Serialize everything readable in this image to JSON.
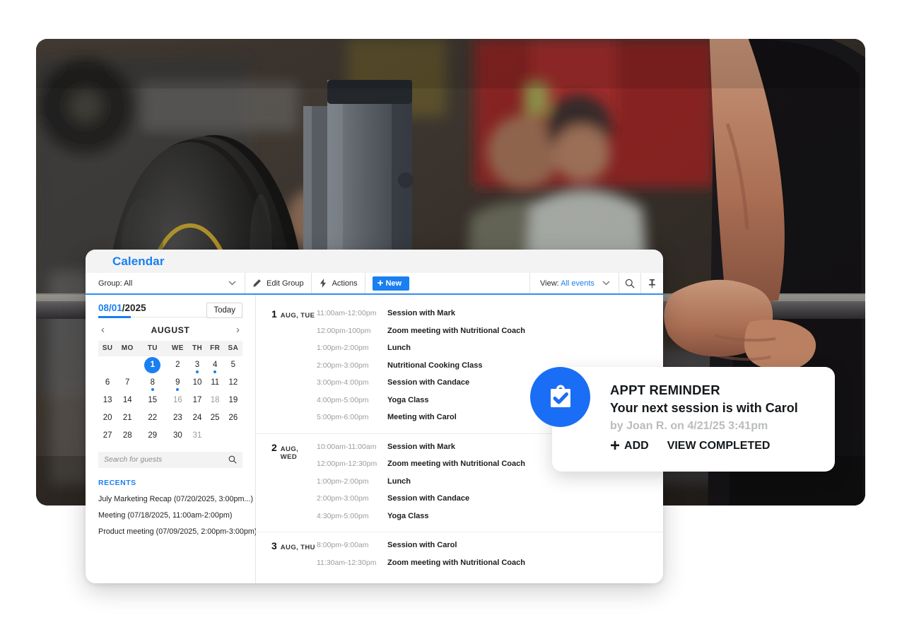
{
  "app": {
    "title": "Calendar"
  },
  "toolbar": {
    "group_label": "Group: All",
    "edit_group_label": "Edit Group",
    "actions_label": "Actions",
    "new_label": "New",
    "new_plus": "+",
    "view_label": "View:",
    "view_value": "All events",
    "accent_color": "#1a7ff0"
  },
  "sidebar": {
    "date_month_day": "08/01",
    "date_year": "/2025",
    "today_label": "Today",
    "month_name": "AUGUST",
    "prev_arrow": "‹",
    "next_arrow": "›",
    "weekdays": [
      "SU",
      "MO",
      "TU",
      "WE",
      "TH",
      "FR",
      "SA"
    ],
    "weeks": [
      [
        {
          "d": "",
          "state": "empty"
        },
        {
          "d": "",
          "state": "empty"
        },
        {
          "d": "1",
          "state": "selected"
        },
        {
          "d": "2",
          "state": "normal"
        },
        {
          "d": "3",
          "state": "normal",
          "dot": true
        },
        {
          "d": "4",
          "state": "normal",
          "dot": true
        },
        {
          "d": "5",
          "state": "normal"
        }
      ],
      [
        {
          "d": "6",
          "state": "normal"
        },
        {
          "d": "7",
          "state": "normal"
        },
        {
          "d": "8",
          "state": "normal",
          "dot": true
        },
        {
          "d": "9",
          "state": "normal",
          "dot": true
        },
        {
          "d": "10",
          "state": "normal"
        },
        {
          "d": "11",
          "state": "normal"
        },
        {
          "d": "12",
          "state": "normal"
        }
      ],
      [
        {
          "d": "13",
          "state": "normal"
        },
        {
          "d": "14",
          "state": "normal"
        },
        {
          "d": "15",
          "state": "normal"
        },
        {
          "d": "16",
          "state": "muted"
        },
        {
          "d": "17",
          "state": "normal"
        },
        {
          "d": "18",
          "state": "muted"
        },
        {
          "d": "19",
          "state": "normal"
        }
      ],
      [
        {
          "d": "20",
          "state": "normal"
        },
        {
          "d": "21",
          "state": "normal"
        },
        {
          "d": "22",
          "state": "normal"
        },
        {
          "d": "23",
          "state": "normal"
        },
        {
          "d": "24",
          "state": "normal"
        },
        {
          "d": "25",
          "state": "normal"
        },
        {
          "d": "26",
          "state": "normal"
        }
      ],
      [
        {
          "d": "27",
          "state": "normal"
        },
        {
          "d": "28",
          "state": "normal"
        },
        {
          "d": "29",
          "state": "normal"
        },
        {
          "d": "30",
          "state": "normal"
        },
        {
          "d": "31",
          "state": "muted"
        },
        {
          "d": "",
          "state": "empty"
        },
        {
          "d": "",
          "state": "empty"
        }
      ]
    ],
    "guest_search_placeholder": "Search for guests",
    "recents_heading": "RECENTS",
    "recents": [
      "July Marketing Recap (07/20/2025, 3:00pm...)",
      "Meeting (07/18/2025, 11:00am-2:00pm)",
      "Product meeting (07/09/2025, 2:00pm-3:00pm)"
    ]
  },
  "event_days": [
    {
      "day": "1",
      "dow": "AUG, TUE",
      "events": [
        {
          "time": "11:00am-12:00pm",
          "name": "Session with Mark"
        },
        {
          "time": "12:00pm-100pm",
          "name": "Zoom meeting with Nutritional Coach"
        },
        {
          "time": "1:00pm-2:00pm",
          "name": "Lunch"
        },
        {
          "time": "2:00pm-3:00pm",
          "name": "Nutritional Cooking Class"
        },
        {
          "time": "3:00pm-4:00pm",
          "name": "Session with Candace"
        },
        {
          "time": "4:00pm-5:00pm",
          "name": "Yoga Class"
        },
        {
          "time": "5:00pm-6:00pm",
          "name": "Meeting with Carol"
        }
      ]
    },
    {
      "day": "2",
      "dow": "AUG, WED",
      "events": [
        {
          "time": "10:00am-11:00am",
          "name": "Session with Mark"
        },
        {
          "time": "12:00pm-12:30pm",
          "name": "Zoom meeting with Nutritional Coach"
        },
        {
          "time": "1:00pm-2:00pm",
          "name": "Lunch"
        },
        {
          "time": "2:00pm-3:00pm",
          "name": "Session with Candace"
        },
        {
          "time": "4:30pm-5:00pm",
          "name": "Yoga Class"
        }
      ]
    },
    {
      "day": "3",
      "dow": "AUG, THU",
      "events": [
        {
          "time": "8:00pm-9:00am",
          "name": "Session with Carol"
        },
        {
          "time": "11:30am-12:30pm",
          "name": "Zoom meeting with Nutritional Coach"
        }
      ]
    }
  ],
  "toast": {
    "title": "APPT REMINDER",
    "subtitle": "Your next session is with Carol",
    "meta": "by Joan R. on 4/21/25 3:41pm",
    "add_label": "ADD",
    "add_plus": "+",
    "view_completed_label": "VIEW COMPLETED",
    "badge_color": "#1a6ef5"
  }
}
